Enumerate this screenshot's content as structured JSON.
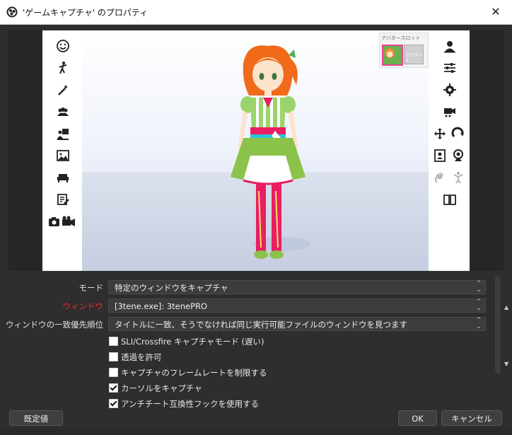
{
  "window": {
    "title": "'ゲームキャプチャ' のプロパティ",
    "close_label": "✕"
  },
  "preview": {
    "avatar_slot_title": "アバタースロット",
    "slot2_label": "アバター2"
  },
  "form": {
    "mode_label": "モード",
    "mode_value": "特定のウィンドウをキャプチャ",
    "window_label": "ウィンドウ",
    "window_value": "[3tene.exe]: 3tenePRO",
    "priority_label": "ウィンドウの一致優先順位",
    "priority_value": "タイトルに一致、そうでなければ同じ実行可能ファイルのウィンドウを見つます",
    "checkboxes": [
      {
        "label": "SLI/Crossfire キャプチャモード (遅い)",
        "checked": false
      },
      {
        "label": "透過を許可",
        "checked": false
      },
      {
        "label": "キャプチャのフレームレートを制限する",
        "checked": false
      },
      {
        "label": "カーソルをキャプチャ",
        "checked": true
      },
      {
        "label": "アンチチート互換性フックを使用する",
        "checked": true
      }
    ]
  },
  "buttons": {
    "defaults": "既定値",
    "ok": "OK",
    "cancel": "キャンセル"
  },
  "colors": {
    "window_label_red": "#e0302a",
    "dialog_bg": "#2e2e2e"
  }
}
